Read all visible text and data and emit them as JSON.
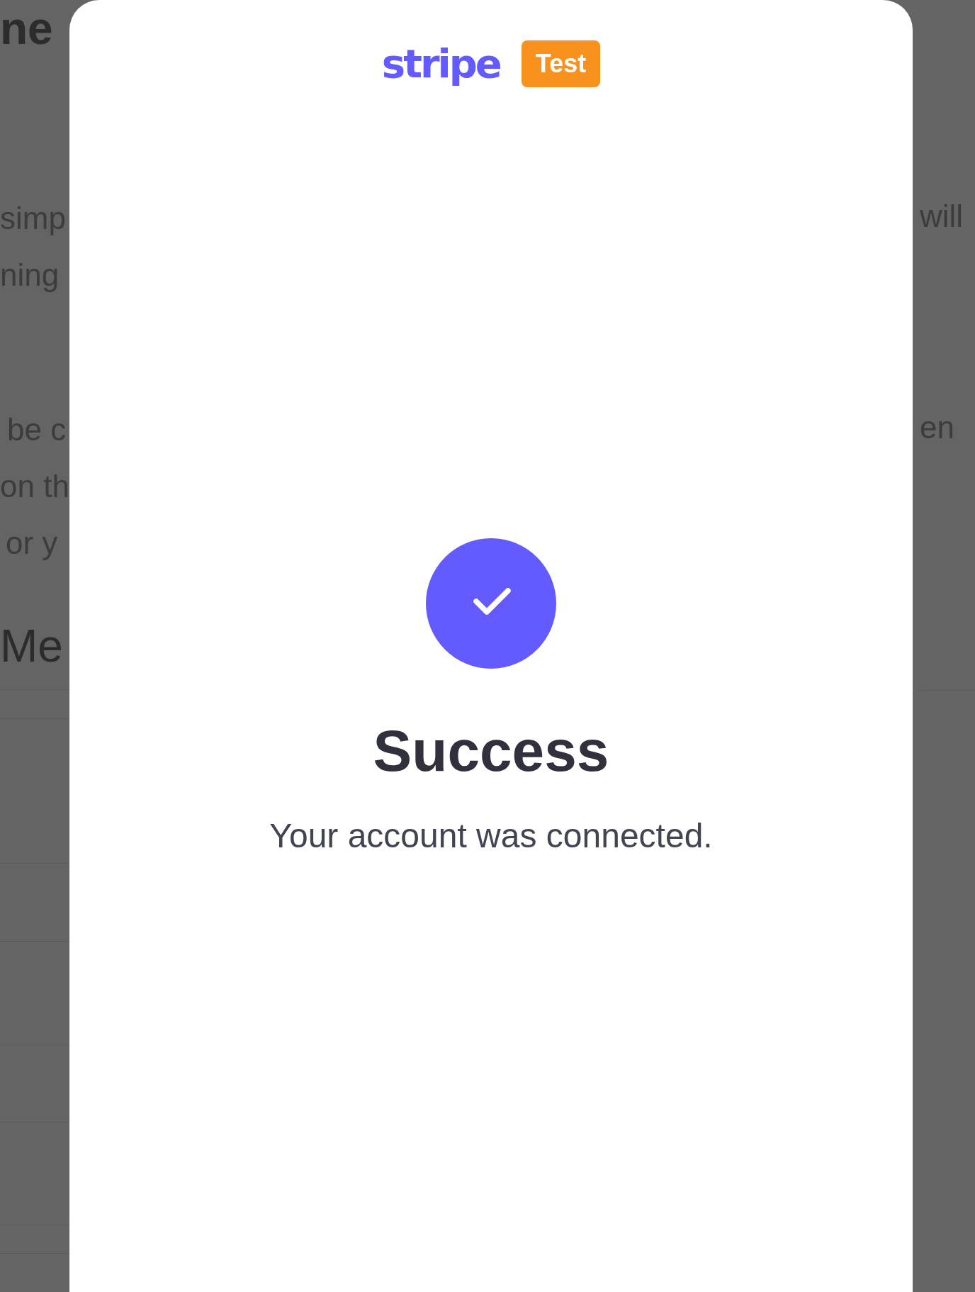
{
  "background": {
    "left_fragments": [
      {
        "text": "ne",
        "kind": "heading"
      },
      {
        "text": "simp",
        "kind": "body"
      },
      {
        "text": "ning",
        "kind": "body"
      },
      {
        "text": "be c",
        "kind": "body"
      },
      {
        "text": "on th",
        "kind": "body"
      },
      {
        "text": "or y",
        "kind": "body"
      },
      {
        "text": "Me",
        "kind": "heading"
      }
    ],
    "right_fragments": [
      {
        "text": "will"
      },
      {
        "text": "en"
      }
    ]
  },
  "modal": {
    "brand": "stripe",
    "badge": "Test",
    "status": {
      "kind": "success"
    },
    "title": "Success",
    "message": "Your account was connected."
  }
}
